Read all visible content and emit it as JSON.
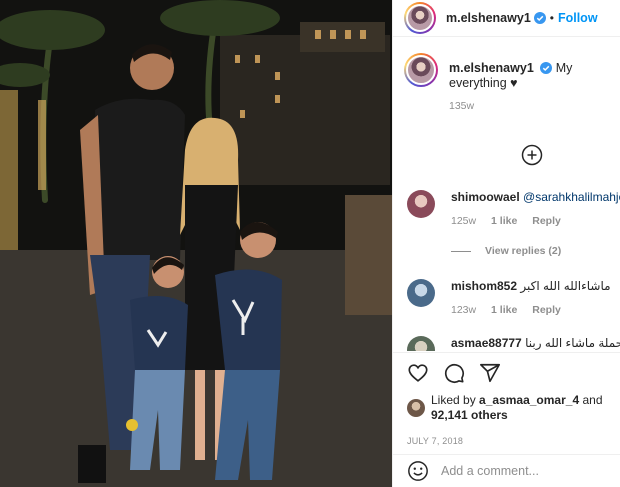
{
  "post": {
    "username": "m.elshenawy1",
    "follow_label": "Follow",
    "dot": "•",
    "caption_text": "My everything",
    "caption_emoji": "♥",
    "caption_time": "135w"
  },
  "comments": [
    {
      "username": "shimoowael",
      "mention": "@sarahkhalilmahjob",
      "text": "",
      "time": "125w",
      "likes": "1 like",
      "reply_label": "Reply"
    },
    {
      "username": "mishom852",
      "mention": "",
      "text": "ماشاءالله الله اكبر",
      "time": "123w",
      "likes": "1 like",
      "reply_label": "Reply"
    },
    {
      "username": "asmae88777",
      "mention": "",
      "text": "حملة ماشاء الله ربنا",
      "time": "",
      "likes": "",
      "reply_label": ""
    }
  ],
  "view_replies_label": "View replies (2)",
  "likes": {
    "liked_by_prefix": "Liked by",
    "liked_by_user": "a_asmaa_omar_4",
    "and": "and",
    "others_count": "92,141 others"
  },
  "date": "JULY 7, 2018",
  "add_comment_placeholder": "Add a comment...",
  "colors": {
    "accent": "#0095f6",
    "text": "#262626",
    "muted": "#8e8e8e"
  },
  "icons": [
    "verified-badge-icon",
    "add-circle-icon",
    "heart-icon",
    "comment-icon",
    "share-icon",
    "emoji-icon"
  ]
}
